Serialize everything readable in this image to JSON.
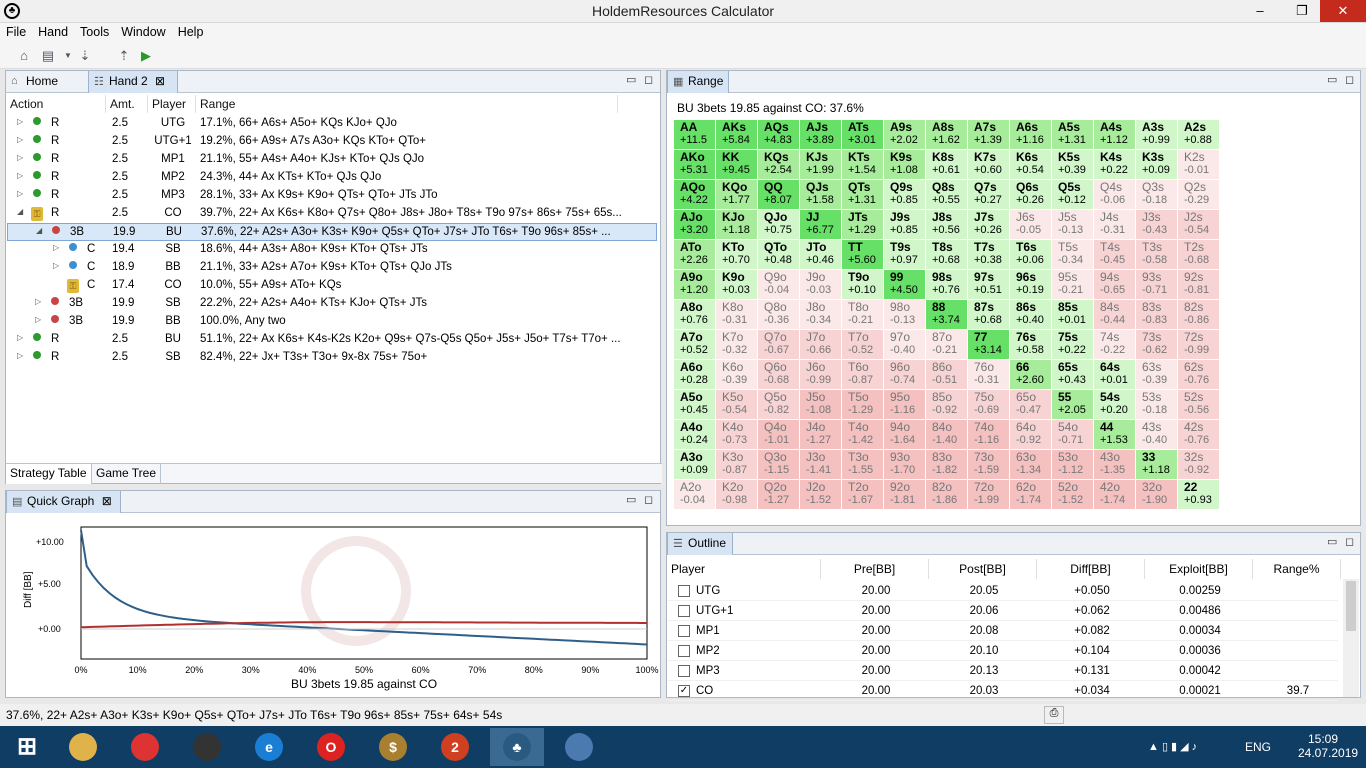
{
  "window": {
    "title": "HoldemResources Calculator",
    "min": "–",
    "max": "❐",
    "close": "✕",
    "app_icon": "♣"
  },
  "menu": [
    "File",
    "Hand",
    "Tools",
    "Window",
    "Help"
  ],
  "toolbar_icons": [
    "home-icon",
    "new-hand-icon",
    "dropdown-icon",
    "import-icon",
    "export-icon",
    "run-icon"
  ],
  "tabs_left": {
    "home": "Home",
    "hand2": "Hand 2"
  },
  "strategy": {
    "headers": [
      "Action",
      "Amt.",
      "Player",
      "Range"
    ],
    "rows": [
      {
        "level": 0,
        "exp": "▷",
        "mark": "green",
        "action": "R",
        "amt": "2.5",
        "player": "UTG",
        "range": "17.1%, 66+ A6s+ A5o+ KQs KJo+ QJo"
      },
      {
        "level": 0,
        "exp": "▷",
        "mark": "green",
        "action": "R",
        "amt": "2.5",
        "player": "UTG+1",
        "range": "19.2%, 66+ A9s+ A7s A3o+ KQs KTo+ QTo+"
      },
      {
        "level": 0,
        "exp": "▷",
        "mark": "green",
        "action": "R",
        "amt": "2.5",
        "player": "MP1",
        "range": "21.1%, 55+ A4s+ A4o+ KJs+ KTo+ QJs QJo"
      },
      {
        "level": 0,
        "exp": "▷",
        "mark": "green",
        "action": "R",
        "amt": "2.5",
        "player": "MP2",
        "range": "24.3%, 44+ Ax KTs+ KTo+ QJs QJo"
      },
      {
        "level": 0,
        "exp": "▷",
        "mark": "green",
        "action": "R",
        "amt": "2.5",
        "player": "MP3",
        "range": "28.1%, 33+ Ax K9s+ K9o+ QTs+ QTo+ JTs JTo"
      },
      {
        "level": 0,
        "exp": "◢",
        "mark": "lock",
        "action": "R",
        "amt": "2.5",
        "player": "CO",
        "range": "39.7%, 22+ Ax K6s+ K8o+ Q7s+ Q8o+ J8s+ J8o+ T8s+ T9o 97s+ 86s+ 75s+ 65s..."
      },
      {
        "level": 1,
        "exp": "◢",
        "mark": "red",
        "action": "3B",
        "amt": "19.9",
        "player": "BU",
        "range": "37.6%, 22+ A2s+ A3o+ K3s+ K9o+ Q5s+ QTo+ J7s+ JTo T6s+ T9o 96s+ 85s+ ...",
        "sel": true
      },
      {
        "level": 2,
        "exp": "▷",
        "mark": "blue",
        "action": "C",
        "amt": "19.4",
        "player": "SB",
        "range": "18.6%, 44+ A3s+ A8o+ K9s+ KTo+ QTs+ JTs"
      },
      {
        "level": 2,
        "exp": "▷",
        "mark": "blue",
        "action": "C",
        "amt": "18.9",
        "player": "BB",
        "range": "21.1%, 33+ A2s+ A7o+ K9s+ KTo+ QTs+ QJo JTs"
      },
      {
        "level": 2,
        "exp": "",
        "mark": "lock",
        "action": "C",
        "amt": "17.4",
        "player": "CO",
        "range": "10.0%, 55+ A9s+ ATo+ KQs"
      },
      {
        "level": 1,
        "exp": "▷",
        "mark": "red",
        "action": "3B",
        "amt": "19.9",
        "player": "SB",
        "range": "22.2%, 22+ A2s+ A4o+ KTs+ KJo+ QTs+ JTs"
      },
      {
        "level": 1,
        "exp": "▷",
        "mark": "red",
        "action": "3B",
        "amt": "19.9",
        "player": "BB",
        "range": "100.0%, Any two"
      },
      {
        "level": 0,
        "exp": "▷",
        "mark": "green",
        "action": "R",
        "amt": "2.5",
        "player": "BU",
        "range": "51.1%, 22+ Ax K6s+ K4s-K2s K2o+ Q9s+ Q7s-Q5s Q5o+ J5s+ J5o+ T7s+ T7o+ ..."
      },
      {
        "level": 0,
        "exp": "▷",
        "mark": "green",
        "action": "R",
        "amt": "2.5",
        "player": "SB",
        "range": "82.4%, 22+ Jx+ T3s+ T3o+ 9x-8x 75s+ 75o+"
      }
    ],
    "bottom_tabs": [
      "Strategy Table",
      "Game Tree"
    ]
  },
  "quickgraph": {
    "tab": "Quick Graph",
    "ylabel": "Diff [BB]",
    "xlabel": "BU 3bets 19.85 against CO",
    "yticks": [
      "+10.00",
      "+5.00",
      "+0.00"
    ],
    "xticks": [
      "0%",
      "10%",
      "20%",
      "30%",
      "40%",
      "50%",
      "60%",
      "70%",
      "80%",
      "90%",
      "100%"
    ]
  },
  "range": {
    "tab": "Range",
    "subtitle": "BU 3bets 19.85 against CO: 37.6%",
    "ranks": [
      "A",
      "K",
      "Q",
      "J",
      "T",
      "9",
      "8",
      "7",
      "6",
      "5",
      "4",
      "3",
      "2"
    ],
    "values": [
      [
        "+11.5",
        "+5.84",
        "+4.83",
        "+3.89",
        "+3.01",
        "+2.02",
        "+1.62",
        "+1.39",
        "+1.16",
        "+1.31",
        "+1.12",
        "+0.99",
        "+0.88"
      ],
      [
        "+5.31",
        "+9.45",
        "+2.54",
        "+1.99",
        "+1.54",
        "+1.08",
        "+0.61",
        "+0.60",
        "+0.54",
        "+0.39",
        "+0.22",
        "+0.09",
        "-0.01"
      ],
      [
        "+4.22",
        "+1.77",
        "+8.07",
        "+1.58",
        "+1.31",
        "+0.85",
        "+0.55",
        "+0.27",
        "+0.26",
        "+0.12",
        "-0.06",
        "-0.18",
        "-0.29"
      ],
      [
        "+3.20",
        "+1.18",
        "+0.75",
        "+6.77",
        "+1.29",
        "+0.85",
        "+0.56",
        "+0.26",
        "-0.05",
        "-0.13",
        "-0.31",
        "-0.43",
        "-0.54"
      ],
      [
        "+2.26",
        "+0.70",
        "+0.48",
        "+0.46",
        "+5.60",
        "+0.97",
        "+0.68",
        "+0.38",
        "+0.06",
        "-0.34",
        "-0.45",
        "-0.58",
        "-0.68"
      ],
      [
        "+1.20",
        "+0.03",
        "-0.04",
        "-0.03",
        "+0.10",
        "+4.50",
        "+0.76",
        "+0.51",
        "+0.19",
        "-0.21",
        "-0.65",
        "-0.71",
        "-0.81"
      ],
      [
        "+0.76",
        "-0.31",
        "-0.36",
        "-0.34",
        "-0.21",
        "-0.13",
        "+3.74",
        "+0.68",
        "+0.40",
        "+0.01",
        "-0.44",
        "-0.83",
        "-0.86"
      ],
      [
        "+0.52",
        "-0.32",
        "-0.67",
        "-0.66",
        "-0.52",
        "-0.40",
        "-0.21",
        "+3.14",
        "+0.58",
        "+0.22",
        "-0.22",
        "-0.62",
        "-0.99"
      ],
      [
        "+0.28",
        "-0.39",
        "-0.68",
        "-0.99",
        "-0.87",
        "-0.74",
        "-0.51",
        "-0.31",
        "+2.60",
        "+0.43",
        "+0.01",
        "-0.39",
        "-0.76"
      ],
      [
        "+0.45",
        "-0.54",
        "-0.82",
        "-1.08",
        "-1.29",
        "-1.16",
        "-0.92",
        "-0.69",
        "-0.47",
        "+2.05",
        "+0.20",
        "-0.18",
        "-0.56"
      ],
      [
        "+0.24",
        "-0.73",
        "-1.01",
        "-1.27",
        "-1.42",
        "-1.64",
        "-1.40",
        "-1.16",
        "-0.92",
        "-0.71",
        "+1.53",
        "-0.40",
        "-0.76"
      ],
      [
        "+0.09",
        "-0.87",
        "-1.15",
        "-1.41",
        "-1.55",
        "-1.70",
        "-1.82",
        "-1.59",
        "-1.34",
        "-1.12",
        "-1.35",
        "+1.18",
        "-0.92"
      ],
      [
        "-0.04",
        "-0.98",
        "-1.27",
        "-1.52",
        "-1.67",
        "-1.81",
        "-1.86",
        "-1.99",
        "-1.74",
        "-1.52",
        "-1.74",
        "-1.90",
        "+0.93"
      ]
    ],
    "in_range": [
      [
        1,
        1,
        1,
        1,
        1,
        1,
        1,
        1,
        1,
        1,
        1,
        1,
        1
      ],
      [
        1,
        1,
        1,
        1,
        1,
        1,
        1,
        1,
        1,
        1,
        1,
        1,
        0
      ],
      [
        1,
        1,
        1,
        1,
        1,
        1,
        1,
        1,
        1,
        1,
        0,
        0,
        0
      ],
      [
        1,
        1,
        1,
        1,
        1,
        1,
        1,
        1,
        0,
        0,
        0,
        0,
        0
      ],
      [
        1,
        1,
        1,
        1,
        1,
        1,
        1,
        1,
        1,
        0,
        0,
        0,
        0
      ],
      [
        1,
        1,
        0,
        0,
        1,
        1,
        1,
        1,
        1,
        0,
        0,
        0,
        0
      ],
      [
        1,
        0,
        0,
        0,
        0,
        0,
        1,
        1,
        1,
        1,
        0,
        0,
        0
      ],
      [
        1,
        0,
        0,
        0,
        0,
        0,
        0,
        1,
        1,
        1,
        0,
        0,
        0
      ],
      [
        1,
        0,
        0,
        0,
        0,
        0,
        0,
        0,
        1,
        1,
        1,
        0,
        0
      ],
      [
        1,
        0,
        0,
        0,
        0,
        0,
        0,
        0,
        0,
        1,
        1,
        0,
        0
      ],
      [
        1,
        0,
        0,
        0,
        0,
        0,
        0,
        0,
        0,
        0,
        1,
        0,
        0
      ],
      [
        1,
        0,
        0,
        0,
        0,
        0,
        0,
        0,
        0,
        0,
        0,
        1,
        0
      ],
      [
        0,
        0,
        0,
        0,
        0,
        0,
        0,
        0,
        0,
        0,
        0,
        0,
        1
      ]
    ]
  },
  "outline": {
    "tab": "Outline",
    "headers": [
      "Player",
      "Pre[BB]",
      "Post[BB]",
      "Diff[BB]",
      "Exploit[BB]",
      "Range%"
    ],
    "rows": [
      {
        "player": "UTG",
        "pre": "20.00",
        "post": "20.05",
        "diff": "+0.050",
        "exploit": "0.00259",
        "range": "",
        "checked": false
      },
      {
        "player": "UTG+1",
        "pre": "20.00",
        "post": "20.06",
        "diff": "+0.062",
        "exploit": "0.00486",
        "range": "",
        "checked": false
      },
      {
        "player": "MP1",
        "pre": "20.00",
        "post": "20.08",
        "diff": "+0.082",
        "exploit": "0.00034",
        "range": "",
        "checked": false
      },
      {
        "player": "MP2",
        "pre": "20.00",
        "post": "20.10",
        "diff": "+0.104",
        "exploit": "0.00036",
        "range": "",
        "checked": false
      },
      {
        "player": "MP3",
        "pre": "20.00",
        "post": "20.13",
        "diff": "+0.131",
        "exploit": "0.00042",
        "range": "",
        "checked": false
      },
      {
        "player": "CO",
        "pre": "20.00",
        "post": "20.03",
        "diff": "+0.034",
        "exploit": "0.00021",
        "range": "39.7",
        "checked": true
      }
    ]
  },
  "status": "37.6%, 22+ A2s+ A3o+ K3s+ K9o+ Q5s+ QTo+ J7s+ JTo T6s+ T9o 96s+ 85s+ 75s+ 64s+ 54s",
  "taskbar": {
    "lang": "ENG",
    "time": "15:09",
    "date": "24.07.2019",
    "apps": [
      {
        "name": "windows-start-icon",
        "label": ""
      },
      {
        "name": "file-explorer-icon",
        "label": ""
      },
      {
        "name": "chrome-icon",
        "label": ""
      },
      {
        "name": "vpn-icon",
        "label": ""
      },
      {
        "name": "internet-explorer-icon",
        "label": "e"
      },
      {
        "name": "opera-icon",
        "label": "O"
      },
      {
        "name": "money-app-icon",
        "label": "$"
      },
      {
        "name": "app-2-icon",
        "label": "2"
      },
      {
        "name": "holdem-app-icon",
        "label": "♣"
      },
      {
        "name": "paint-icon",
        "label": ""
      }
    ]
  },
  "colors": {
    "accent": "#3a6ea5",
    "in_range_strong": "#66e066",
    "in_range": "#c6f4c6",
    "out_range": "#f8d6d6",
    "out_range_neutral": "#fbf0f0"
  }
}
